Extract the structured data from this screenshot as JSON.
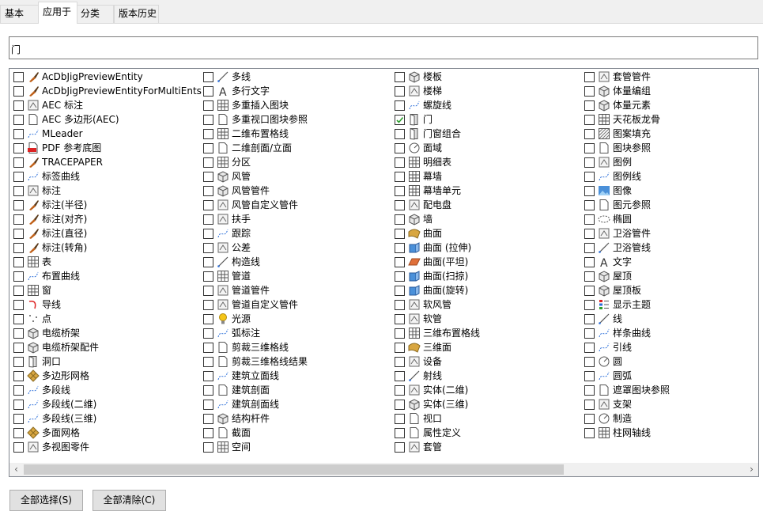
{
  "tabs": [
    "基本",
    "应用于",
    "分类",
    "版本历史"
  ],
  "active_tab": "应用于",
  "search": {
    "value": "门"
  },
  "columns": [
    [
      {
        "label": "AcDbJigPreviewEntity",
        "icon": "brush-icon"
      },
      {
        "label": "AcDbJigPreviewEntityForMultiEnts",
        "icon": "brush-icon"
      },
      {
        "label": "AEC 标注",
        "icon": "dimension-icon"
      },
      {
        "label": "AEC 多边形(AEC)",
        "icon": "polygon-icon"
      },
      {
        "label": "MLeader",
        "icon": "mleader-icon"
      },
      {
        "label": "PDF 参考底图",
        "icon": "pdf-icon"
      },
      {
        "label": "TRACEPAPER",
        "icon": "brush-icon"
      },
      {
        "label": "标签曲线",
        "icon": "tag-curve-icon"
      },
      {
        "label": "标注",
        "icon": "dim-icon"
      },
      {
        "label": "标注(半径)",
        "icon": "brush-icon"
      },
      {
        "label": "标注(对齐)",
        "icon": "brush-icon"
      },
      {
        "label": "标注(直径)",
        "icon": "brush-icon"
      },
      {
        "label": "标注(转角)",
        "icon": "brush-icon"
      },
      {
        "label": "表",
        "icon": "table-icon"
      },
      {
        "label": "布置曲线",
        "icon": "layout-curve-icon"
      },
      {
        "label": "窗",
        "icon": "window-icon"
      },
      {
        "label": "导线",
        "icon": "wire-icon"
      },
      {
        "label": "点",
        "icon": "point-icon"
      },
      {
        "label": "电缆桥架",
        "icon": "cable-tray-icon"
      },
      {
        "label": "电缆桥架配件",
        "icon": "cable-fitting-icon"
      },
      {
        "label": "洞口",
        "icon": "opening-icon"
      },
      {
        "label": "多边形网格",
        "icon": "mesh-icon"
      },
      {
        "label": "多段线",
        "icon": "polyline-icon"
      },
      {
        "label": "多段线(二维)",
        "icon": "polyline-icon"
      },
      {
        "label": "多段线(三维)",
        "icon": "polyline-3d-icon"
      },
      {
        "label": "多面网格",
        "icon": "polyface-icon"
      },
      {
        "label": "多视图零件",
        "icon": "mvpart-icon"
      }
    ],
    [
      {
        "label": "多线",
        "icon": "mline-icon"
      },
      {
        "label": "多行文字",
        "icon": "mtext-icon"
      },
      {
        "label": "多重插入图块",
        "icon": "minsert-icon"
      },
      {
        "label": "多重视口图块参照",
        "icon": "mvblock-icon"
      },
      {
        "label": "二维布置格线",
        "icon": "grid-icon"
      },
      {
        "label": "二维剖面/立面",
        "icon": "section-icon"
      },
      {
        "label": "分区",
        "icon": "zone-icon"
      },
      {
        "label": "风管",
        "icon": "duct-icon"
      },
      {
        "label": "风管管件",
        "icon": "duct-fitting-icon"
      },
      {
        "label": "风管自定义管件",
        "icon": "duct-custom-icon"
      },
      {
        "label": "扶手",
        "icon": "railing-icon"
      },
      {
        "label": "跟踪",
        "icon": "trace-icon"
      },
      {
        "label": "公差",
        "icon": "tolerance-icon"
      },
      {
        "label": "构造线",
        "icon": "xline-icon"
      },
      {
        "label": "管道",
        "icon": "pipe-icon"
      },
      {
        "label": "管道管件",
        "icon": "pipe-fitting-icon"
      },
      {
        "label": "管道自定义管件",
        "icon": "pipe-custom-icon"
      },
      {
        "label": "光源",
        "icon": "light-icon"
      },
      {
        "label": "弧标注",
        "icon": "arc-dim-icon"
      },
      {
        "label": "剪裁三维格线",
        "icon": "clip-grid-icon"
      },
      {
        "label": "剪裁三维格线结果",
        "icon": "clip-grid-icon"
      },
      {
        "label": "建筑立面线",
        "icon": "elevation-line-icon"
      },
      {
        "label": "建筑剖面",
        "icon": "bldg-section-icon"
      },
      {
        "label": "建筑剖面线",
        "icon": "section-line-icon"
      },
      {
        "label": "结构杆件",
        "icon": "member-icon"
      },
      {
        "label": "截面",
        "icon": "cut-plane-icon"
      },
      {
        "label": "空间",
        "icon": "space-icon"
      }
    ],
    [
      {
        "label": "楼板",
        "icon": "slab-icon"
      },
      {
        "label": "楼梯",
        "icon": "stair-icon"
      },
      {
        "label": "螺旋线",
        "icon": "helix-icon"
      },
      {
        "label": "门",
        "icon": "door-icon",
        "checked": true
      },
      {
        "label": "门窗组合",
        "icon": "door-window-icon"
      },
      {
        "label": "面域",
        "icon": "region-icon"
      },
      {
        "label": "明细表",
        "icon": "schedule-icon"
      },
      {
        "label": "幕墙",
        "icon": "curtain-wall-icon"
      },
      {
        "label": "幕墙单元",
        "icon": "curtain-unit-icon"
      },
      {
        "label": "配电盘",
        "icon": "panel-icon"
      },
      {
        "label": "墙",
        "icon": "wall-icon"
      },
      {
        "label": "曲面",
        "icon": "surface-icon"
      },
      {
        "label": "曲面 (拉伸)",
        "icon": "surface-extrude-icon"
      },
      {
        "label": "曲面(平坦)",
        "icon": "surface-flat-icon"
      },
      {
        "label": "曲面(扫掠)",
        "icon": "surface-sweep-icon"
      },
      {
        "label": "曲面(旋转)",
        "icon": "surface-revolve-icon"
      },
      {
        "label": "软风管",
        "icon": "flex-duct-icon"
      },
      {
        "label": "软管",
        "icon": "flex-pipe-icon"
      },
      {
        "label": "三维布置格线",
        "icon": "grid-3d-icon"
      },
      {
        "label": "三维面",
        "icon": "face-3d-icon"
      },
      {
        "label": "设备",
        "icon": "device-icon"
      },
      {
        "label": "射线",
        "icon": "ray-icon"
      },
      {
        "label": "实体(二维)",
        "icon": "solid-2d-icon"
      },
      {
        "label": "实体(三维)",
        "icon": "solid-3d-icon"
      },
      {
        "label": "视口",
        "icon": "viewport-icon"
      },
      {
        "label": "属性定义",
        "icon": "attdef-icon"
      },
      {
        "label": "套管",
        "icon": "sleeve-icon"
      }
    ],
    [
      {
        "label": "套管管件",
        "icon": "sleeve-fitting-icon"
      },
      {
        "label": "体量编组",
        "icon": "mass-group-icon"
      },
      {
        "label": "体量元素",
        "icon": "mass-element-icon"
      },
      {
        "label": "天花板龙骨",
        "icon": "ceiling-grid-icon"
      },
      {
        "label": "图案填充",
        "icon": "hatch-icon"
      },
      {
        "label": "图块参照",
        "icon": "block-ref-icon"
      },
      {
        "label": "图例",
        "icon": "legend-icon"
      },
      {
        "label": "图例线",
        "icon": "legend-line-icon"
      },
      {
        "label": "图像",
        "icon": "image-icon"
      },
      {
        "label": "图元参照",
        "icon": "element-ref-icon"
      },
      {
        "label": "椭圆",
        "icon": "ellipse-icon"
      },
      {
        "label": "卫浴管件",
        "icon": "plumbing-fitting-icon"
      },
      {
        "label": "卫浴管线",
        "icon": "plumbing-line-icon"
      },
      {
        "label": "文字",
        "icon": "text-icon"
      },
      {
        "label": "屋顶",
        "icon": "roof-icon"
      },
      {
        "label": "屋顶板",
        "icon": "roof-slab-icon"
      },
      {
        "label": "显示主题",
        "icon": "display-theme-icon"
      },
      {
        "label": "线",
        "icon": "line-icon"
      },
      {
        "label": "样条曲线",
        "icon": "spline-icon"
      },
      {
        "label": "引线",
        "icon": "leader-icon"
      },
      {
        "label": "圆",
        "icon": "circle-icon"
      },
      {
        "label": "圆弧",
        "icon": "arc-icon"
      },
      {
        "label": "遮罩图块参照",
        "icon": "mask-block-icon"
      },
      {
        "label": "支架",
        "icon": "support-icon"
      },
      {
        "label": "制造",
        "icon": "fabrication-icon"
      },
      {
        "label": "柱网轴线",
        "icon": "column-grid-icon"
      }
    ]
  ],
  "buttons": {
    "select_all": "全部选择(S)",
    "clear_all": "全部清除(C)"
  },
  "scrollbar": {
    "left_arrow": "‹",
    "right_arrow": "›"
  }
}
